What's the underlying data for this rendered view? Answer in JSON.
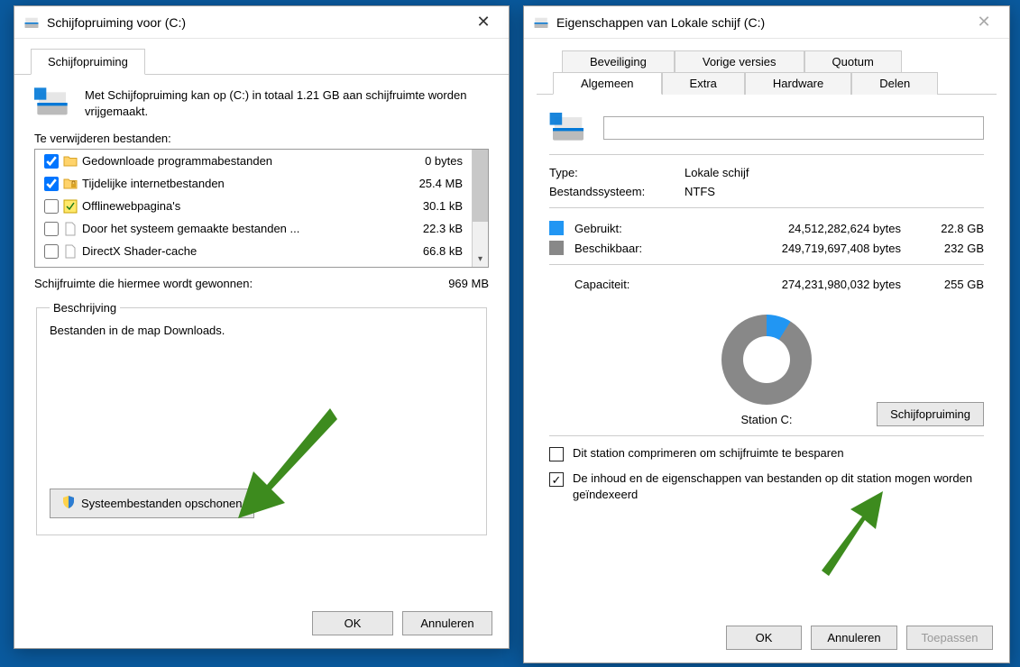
{
  "cleanup": {
    "title": "Schijfopruiming voor  (C:)",
    "tab": "Schijfopruiming",
    "intro": "Met Schijfopruiming kan op  (C:) in totaal 1.21 GB aan schijfruimte worden vrijgemaakt.",
    "list_label": "Te verwijderen bestanden:",
    "files": [
      {
        "checked": true,
        "icon": "folder",
        "name": "Gedownloade programmabestanden",
        "size": "0 bytes"
      },
      {
        "checked": true,
        "icon": "folder-lock",
        "name": "Tijdelijke internetbestanden",
        "size": "25.4 MB"
      },
      {
        "checked": false,
        "icon": "offline",
        "name": "Offlinewebpagina's",
        "size": "30.1 kB"
      },
      {
        "checked": false,
        "icon": "file",
        "name": "Door het systeem gemaakte bestanden ...",
        "size": "22.3 kB"
      },
      {
        "checked": false,
        "icon": "file",
        "name": "DirectX Shader-cache",
        "size": "66.8 kB"
      }
    ],
    "gain_label": "Schijfruimte die hiermee wordt gewonnen:",
    "gain_value": "969 MB",
    "desc_legend": "Beschrijving",
    "desc_text": "Bestanden in de map Downloads.",
    "sys_button": "Systeembestanden opschonen",
    "ok": "OK",
    "cancel": "Annuleren"
  },
  "props": {
    "title": "Eigenschappen van Lokale schijf (C:)",
    "tabs_top": [
      "Beveiliging",
      "Vorige versies",
      "Quotum"
    ],
    "tabs_bot": [
      "Algemeen",
      "Extra",
      "Hardware",
      "Delen"
    ],
    "active_tab": "Algemeen",
    "type_label": "Type:",
    "type_value": "Lokale schijf",
    "fs_label": "Bestandssysteem:",
    "fs_value": "NTFS",
    "used_label": "Gebruikt:",
    "used_bytes": "24,512,282,624 bytes",
    "used_gb": "22.8 GB",
    "free_label": "Beschikbaar:",
    "free_bytes": "249,719,697,408 bytes",
    "free_gb": "232 GB",
    "cap_label": "Capaciteit:",
    "cap_bytes": "274,231,980,032 bytes",
    "cap_gb": "255 GB",
    "station_label": "Station C:",
    "cleanup_button": "Schijfopruiming",
    "check1": "Dit station comprimeren om schijfruimte te besparen",
    "check2": "De inhoud en de eigenschappen van bestanden op dit station mogen worden geïndexeerd",
    "ok": "OK",
    "cancel": "Annuleren",
    "apply": "Toepassen"
  },
  "colors": {
    "used": "#2196f3",
    "free": "#888888",
    "arrow": "#3d8b1e"
  }
}
